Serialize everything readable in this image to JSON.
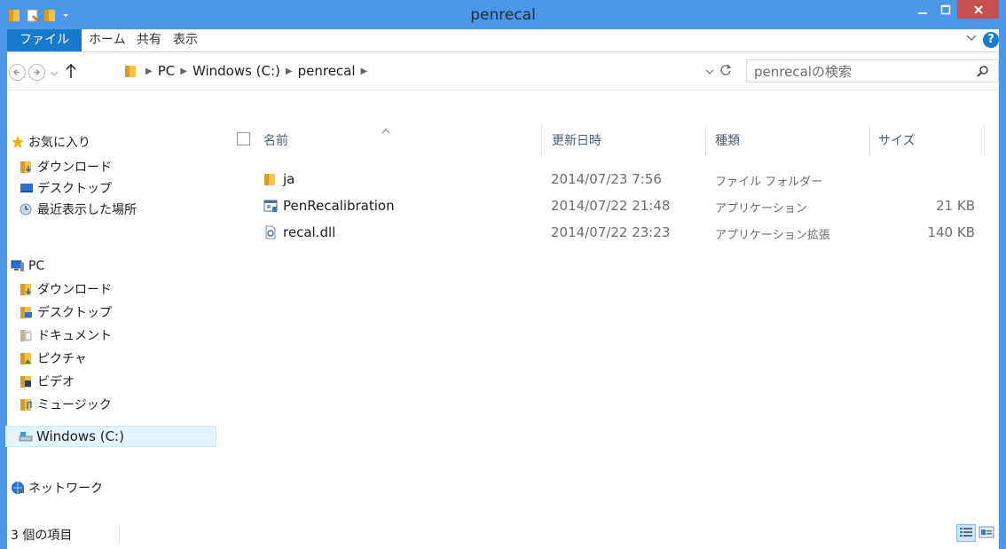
{
  "window": {
    "title": "penrecal"
  },
  "ribbon": {
    "tabs": [
      "ファイル",
      "ホーム",
      "共有",
      "表示"
    ]
  },
  "address": {
    "segments": [
      "PC",
      "Windows (C:)",
      "penrecal"
    ]
  },
  "search": {
    "placeholder": "penrecalの検索"
  },
  "nav": {
    "favorites_label": "お気に入り",
    "favorites": [
      "ダウンロード",
      "デスクトップ",
      "最近表示した場所"
    ],
    "pc_label": "PC",
    "pc_items": [
      "ダウンロード",
      "デスクトップ",
      "ドキュメント",
      "ピクチャ",
      "ビデオ",
      "ミュージック",
      "Windows (C:)"
    ],
    "network_label": "ネットワーク"
  },
  "columns": {
    "name": "名前",
    "date": "更新日時",
    "type": "種類",
    "size": "サイズ"
  },
  "files": [
    {
      "name": "ja",
      "date": "2014/07/23 7:56",
      "type": "ファイル フォルダー",
      "size": ""
    },
    {
      "name": "PenRecalibration",
      "date": "2014/07/22 21:48",
      "type": "アプリケーション",
      "size": "21 KB"
    },
    {
      "name": "recal.dll",
      "date": "2014/07/22 23:23",
      "type": "アプリケーション拡張",
      "size": "140 KB"
    }
  ],
  "status": {
    "item_count": "3 個の項目"
  },
  "colors": {
    "accent": "#1979ca",
    "titlebar": "#4d97e8",
    "close": "#c75050",
    "selection": "#e5f3fb"
  }
}
